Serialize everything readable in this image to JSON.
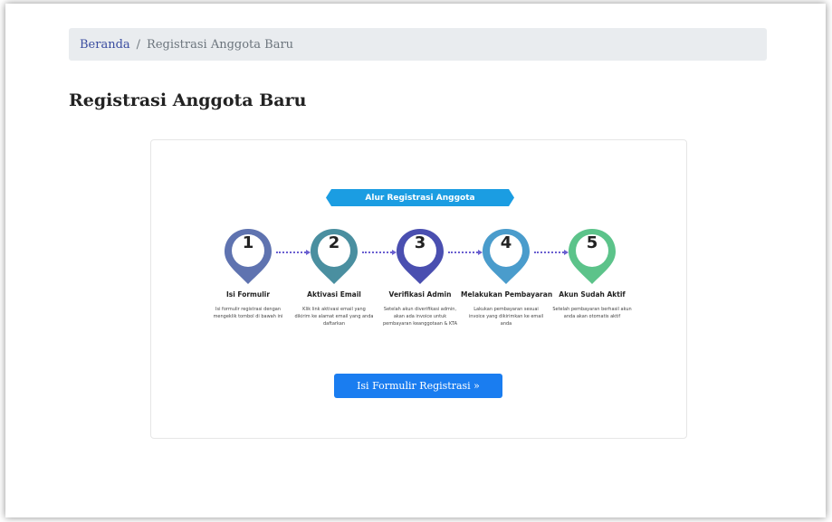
{
  "breadcrumb": {
    "home": "Beranda",
    "separator": "/",
    "current": "Registrasi Anggota Baru"
  },
  "page_title": "Registrasi Anggota Baru",
  "flow": {
    "banner": "Alur Registrasi Anggota",
    "steps": [
      {
        "number": "1",
        "title": "Isi Formulir",
        "description": "Isi formulir registrasi dengan mengeklik tombol di bawah ini",
        "color": "#5f73b0"
      },
      {
        "number": "2",
        "title": "Aktivasi Email",
        "description": "Klik link aktivasi email yang dikirim ke alamat email yang anda daftarkan",
        "color": "#4a8fa0"
      },
      {
        "number": "3",
        "title": "Verifikasi Admin",
        "description": "Setelah akun diverifikasi admin, akan ada invoice untuk pembayaran keanggotaan & KTA",
        "color": "#4a4fb0"
      },
      {
        "number": "4",
        "title": "Melakukan Pembayaran",
        "description": "Lakukan pembayaran sesuai invoice yang dikirimkan ke email anda",
        "color": "#4a9ccc"
      },
      {
        "number": "5",
        "title": "Akun Sudah Aktif",
        "description": "Setelah pembayaran berhasil akun anda akan otomatis aktif",
        "color": "#5cc38a"
      }
    ]
  },
  "cta_label": "Isi Formulir Registrasi »",
  "colors": {
    "breadcrumb_link": "#3a4da0",
    "banner": "#1b9de2",
    "button": "#1a7df0",
    "connector": "#6a5fd0"
  }
}
